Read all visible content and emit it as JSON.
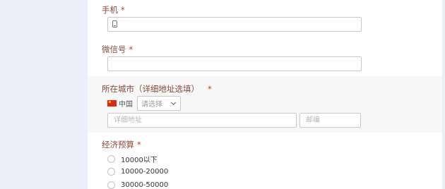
{
  "form": {
    "phone": {
      "label": "手机",
      "required_mark": "*",
      "value": ""
    },
    "wechat": {
      "label": "微信号",
      "required_mark": "*",
      "value": ""
    },
    "city": {
      "label": "所在城市（详细地址选填）",
      "required_mark": "*",
      "country": "中国",
      "region_placeholder": "请选择",
      "address_placeholder": "详细地址",
      "postcode_placeholder": "邮编"
    },
    "budget": {
      "label": "经济预算",
      "required_mark": "*",
      "options": [
        "10000以下",
        "10000-20000",
        "30000-50000"
      ]
    }
  },
  "colors": {
    "page_background": "#eceef9",
    "label_color": "#8a4b3c",
    "required_color": "#c23b22"
  },
  "icons": [
    "phone-icon",
    "china-flag-icon",
    "chevron-down-icon"
  ]
}
